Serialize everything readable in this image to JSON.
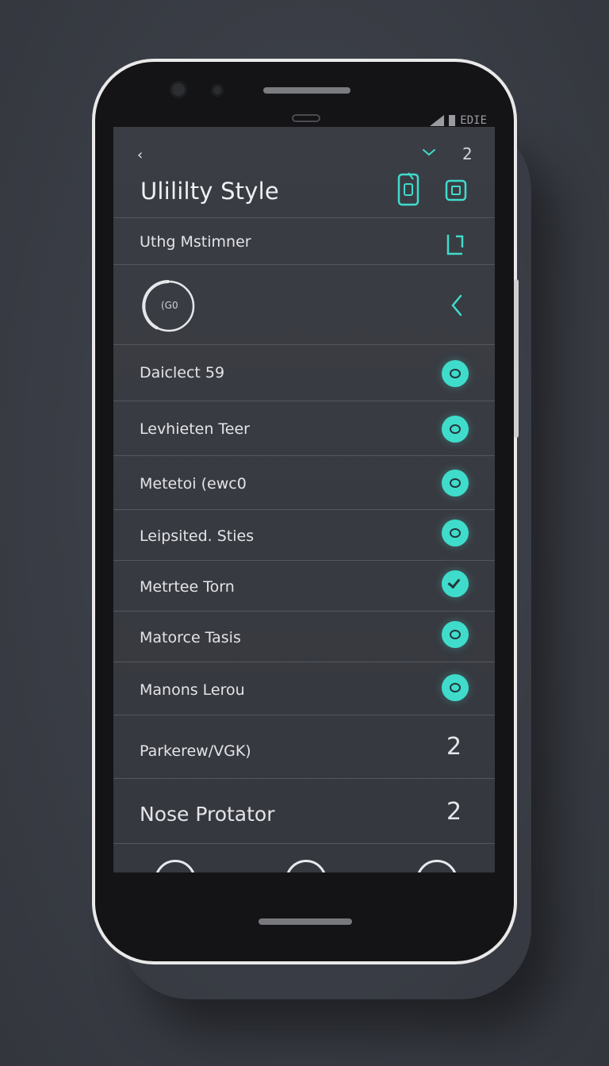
{
  "status_bar": {
    "text": "EDIE"
  },
  "header": {
    "title": "Ulililty Style",
    "top_right_number": "2"
  },
  "rows": [
    {
      "label": "Uthg Mstimner"
    },
    {
      "label": "(G0"
    },
    {
      "label": "Daiclect 59",
      "toggle": "on"
    },
    {
      "label": "Levhieten Teer",
      "toggle": "on"
    },
    {
      "label": "Metetoi  (ewc0",
      "toggle": "on"
    },
    {
      "label": "Leipsited. Sties",
      "toggle": "on"
    },
    {
      "label": "Metrtee  Torn",
      "toggle": "checked"
    },
    {
      "label": "Matorce Tasis",
      "toggle": "on"
    },
    {
      "label": "Manons  Lerou",
      "toggle": "on"
    },
    {
      "label": "Parkerew/VGK)",
      "value": "2"
    },
    {
      "label": "Nose Protator",
      "value": "2"
    }
  ],
  "colors": {
    "accent": "#3fdccb",
    "screen_bg": "#3b3d44",
    "divider": "#55575e",
    "text": "#e6e7ea",
    "page_bg": "#3a3d45"
  }
}
